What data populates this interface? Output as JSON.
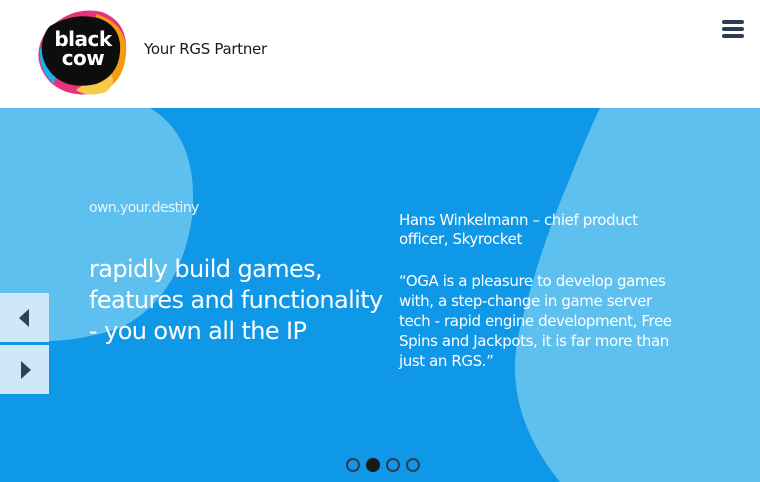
{
  "header": {
    "logo_text_line1": "black",
    "logo_text_line2": "cow",
    "tagline": "Your RGS Partner",
    "menu_icon": "hamburger-menu-icon"
  },
  "hero": {
    "kicker": "own.your.destiny",
    "headline": "rapidly build games, features and functionality - you own all the IP",
    "quote_author": "Hans Winkelmann – chief product officer, Skyrocket",
    "quote_text": "“OGA is a pleasure to develop games with, a step-change in game server tech - rapid engine development, Free Spins and Jackpots, it is far more than just an RGS.”",
    "prev_icon": "chevron-left-icon",
    "next_icon": "chevron-right-icon"
  },
  "carousel": {
    "slide_count": 4,
    "active_index": 1
  },
  "colors": {
    "hero_bg": "#0f97e8",
    "hero_shape": "#5ec0ef",
    "text_dark": "#1a1a1a",
    "accent_icons": "#2d3d52"
  }
}
